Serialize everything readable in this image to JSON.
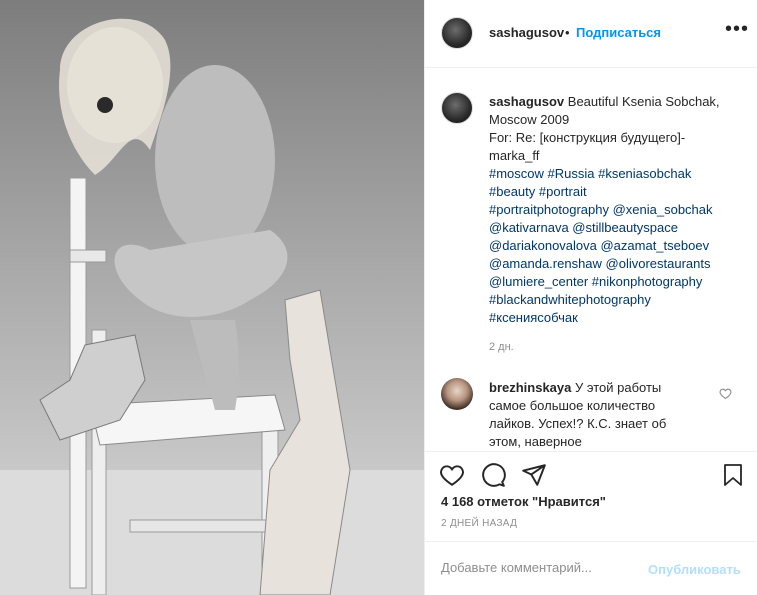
{
  "post": {
    "username": "sashagusov",
    "separator": "•",
    "follow_label": "Подписаться",
    "more_label": "•••"
  },
  "caption": {
    "username": "sashagusov",
    "text_lines": [
      "Beautiful Ksenia Sobchak,",
      "Moscow 2009",
      "For: Re: [конструкция будущего]-",
      "marka_ff"
    ],
    "tag_lines": [
      "#moscow #Russia #kseniasobchak",
      "#beauty #portrait",
      "#portraitphotography @xenia_sobchak",
      "@kativarnava @stillbeautyspace",
      "@dariakonovalova @azamat_tseboev",
      "@amanda.renshaw @olivorestaurants",
      "@lumiere_center #nikonphotography",
      "#blackandwhitephotography",
      "#ксениясобчак"
    ],
    "time": "2 дн."
  },
  "reply": {
    "username": "brezhinskaya",
    "lines": [
      "У этой работы",
      "самое большое количество",
      "лайков. Успех!? К.С. знает об",
      "этом, наверное"
    ]
  },
  "icons": {
    "like": "heart-icon",
    "comment": "comment-bubble-icon",
    "share": "paper-plane-icon",
    "save": "bookmark-icon",
    "comment_like": "small-heart-icon"
  },
  "likes_text": "4 168 отметок \"Нравится\"",
  "date_text": "2 ДНЕЙ НАЗАД",
  "add_comment": {
    "placeholder": "Добавьте комментарий...",
    "post_label": "Опубликовать"
  },
  "colors": {
    "accent": "#0095f6",
    "hashtag": "#00376b",
    "muted": "#8e8e8e",
    "post_disabled": "#b2dffc"
  }
}
